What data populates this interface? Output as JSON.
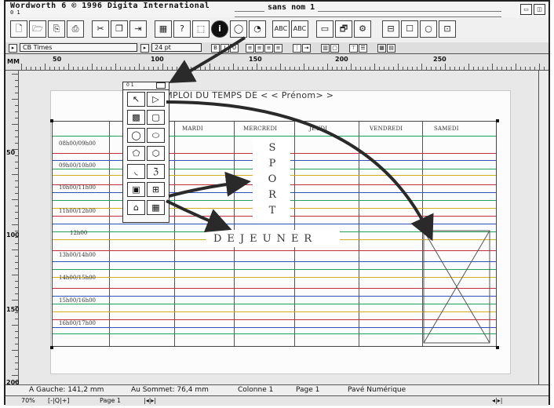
{
  "window": {
    "app_title": "Wordworth 6  © 1996 Digita International",
    "doc_title": "sans nom 1",
    "sub": "0 1"
  },
  "toolbar": {
    "icons": [
      "new-doc-icon",
      "open-icon",
      "save-icon",
      "print-icon",
      "pointer-icon",
      "copy-icon",
      "paste-icon",
      "chart-icon",
      "help-icon",
      "select-icon",
      "info-icon",
      "zoom-icon",
      "magnify-icon",
      "spellcheck-icon",
      "thesaurus-icon",
      "frame-icon",
      "picture-icon",
      "tool-icon",
      "table-icon",
      "circle-icon",
      "page-icon"
    ],
    "spell_label": "ABC",
    "info_label": "i",
    "help_label": "?"
  },
  "formatbar": {
    "font_name": "CB Times",
    "font_size": "24 pt"
  },
  "ruler": {
    "unit": "MM",
    "labels": [
      "50",
      "100",
      "150",
      "200",
      "250"
    ]
  },
  "vruler": {
    "labels": [
      "50",
      "100",
      "150",
      "200"
    ]
  },
  "document": {
    "heading": "EMPLOI DU TEMPS DE  < < Prénom> >",
    "days": [
      "MARDI",
      "MERCREDI",
      "JEUDI",
      "VENDREDI",
      "SAMEDI"
    ],
    "slots": [
      "08h00/09h00",
      "09h00/10h00",
      "10h00/11h00",
      "11h00/12h00",
      "12h00",
      "13h00/14h00",
      "14h00/15h00",
      "15h00/16h00",
      "16h00/17h00"
    ],
    "sport_letters": [
      "S",
      "P",
      "O",
      "R",
      "T"
    ],
    "lunch": "DEJEUNER"
  },
  "palette": {
    "title_left": "0 1",
    "tools": [
      "arrow-tool-icon",
      "text-frame-icon",
      "rect-fill-icon",
      "rounded-rect-icon",
      "ellipse-icon",
      "rounded-box-icon",
      "polygon-icon",
      "hexagon-icon",
      "arc-icon",
      "freehand-icon",
      "frame-tool-icon",
      "picture-frame-icon",
      "image-icon",
      "grid-icon"
    ]
  },
  "status": {
    "left": "A Gauche: 141,2 mm",
    "top": "Au Sommet: 76,4 mm",
    "column": "Colonne 1",
    "page": "Page 1",
    "mode": "Pavé Numérique"
  },
  "scroll": {
    "zoom": "70%",
    "page_label": "Page 1"
  },
  "colors": {
    "row_green": "#22a05a",
    "row_red": "#c0303a",
    "row_blue": "#3050b8",
    "row_yellow": "#d0b020",
    "arrow": "#2a2a2a"
  }
}
